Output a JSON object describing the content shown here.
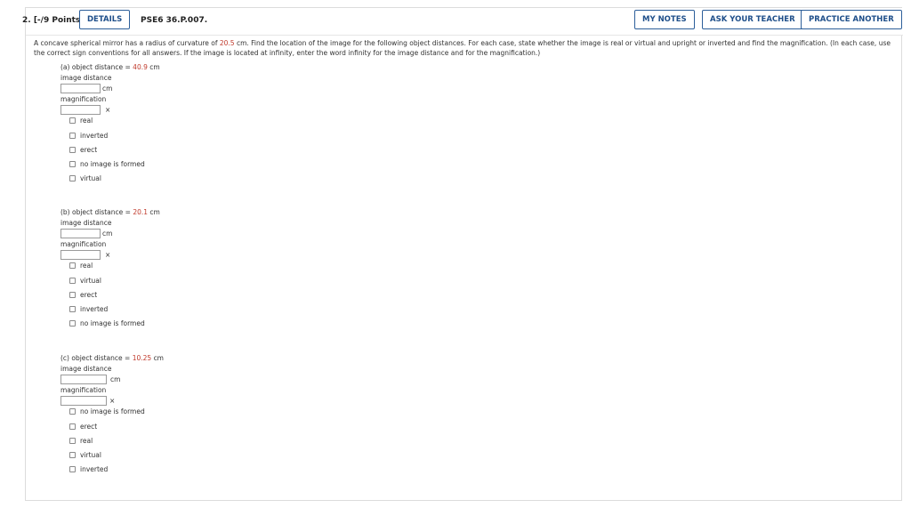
{
  "header": {
    "question_label": "2. [-/9 Points]",
    "details_label": "DETAILS",
    "code": "PSE6 36.P.007.",
    "my_notes_label": "MY NOTES",
    "ask_teacher_label": "ASK YOUR TEACHER",
    "practice_label": "PRACTICE ANOTHER"
  },
  "prompt": {
    "before": "A concave spherical mirror has a radius of curvature of ",
    "radius": "20.5",
    "after": " cm. Find the location of the image for the following object distances. For each case, state whether the image is real or virtual and upright or inverted and find the magnification. (In each case, use the correct sign conventions for all answers. If the image is located at infinity, enter the word infinity for the image distance and for the magnification.)"
  },
  "parts": [
    {
      "label_prefix": "(a) object distance = ",
      "distance": "40.9",
      "unit": "cm",
      "image_label": "image distance",
      "image_unit": "cm",
      "image_value": "",
      "mag_label": "magnification",
      "mag_unit": "×",
      "mag_value": "",
      "options": [
        "real",
        "inverted",
        "erect",
        "no image is formed",
        "virtual"
      ]
    },
    {
      "label_prefix": "(b) object distance = ",
      "distance": "20.1",
      "unit": "cm",
      "image_label": "image distance",
      "image_unit": "cm",
      "image_value": "",
      "mag_label": "magnification",
      "mag_unit": "×",
      "mag_value": "",
      "options": [
        "real",
        "virtual",
        "erect",
        "inverted",
        "no image is formed"
      ]
    },
    {
      "label_prefix": "(c) object distance = ",
      "distance": "10.25",
      "unit": "cm",
      "image_label": "image distance",
      "image_unit": "cm",
      "image_value": "",
      "mag_label": "magnification",
      "mag_unit": "×",
      "mag_value": "",
      "options": [
        "no image is formed",
        "erect",
        "real",
        "virtual",
        "inverted"
      ]
    }
  ],
  "colors": {
    "accent": "#1f4f8a",
    "given_value": "#c0392b"
  }
}
